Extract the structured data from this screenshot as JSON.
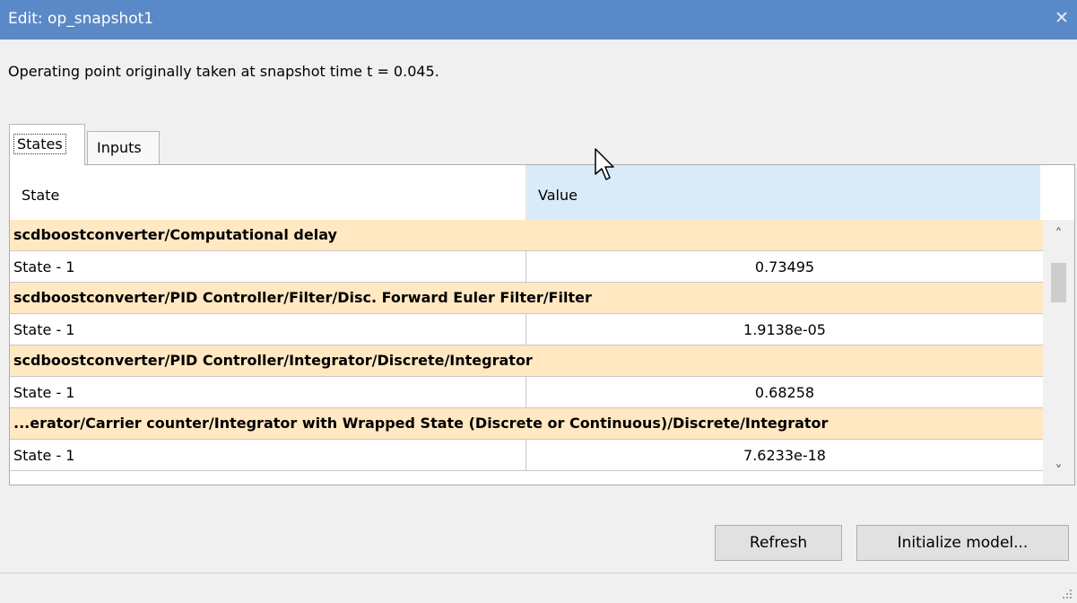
{
  "window": {
    "title": "Edit: op_snapshot1",
    "close_glyph": "✕"
  },
  "info": {
    "text": "Operating point originally taken at snapshot time t = 0.045."
  },
  "tabs": [
    {
      "label": "States",
      "selected": true
    },
    {
      "label": "Inputs",
      "selected": false
    }
  ],
  "table": {
    "columns": [
      "State",
      "Value"
    ],
    "rows": [
      {
        "kind": "group",
        "label": "scdboostconverter/Computational delay"
      },
      {
        "kind": "state",
        "name": "State - 1",
        "value": "0.73495"
      },
      {
        "kind": "group",
        "label": "scdboostconverter/PID Controller/Filter/Disc. Forward Euler Filter/Filter"
      },
      {
        "kind": "state",
        "name": "State - 1",
        "value": "1.9138e-05"
      },
      {
        "kind": "group",
        "label": "scdboostconverter/PID Controller/Integrator/Discrete/Integrator"
      },
      {
        "kind": "state",
        "name": "State - 1",
        "value": "0.68258"
      },
      {
        "kind": "group",
        "label": "...erator/Carrier counter/Integrator with Wrapped State (Discrete or Continuous)/Discrete/Integrator"
      },
      {
        "kind": "state",
        "name": "State - 1",
        "value": "7.6233e-18"
      }
    ]
  },
  "scrollbar": {
    "up_glyph": "˄",
    "down_glyph": "˅"
  },
  "buttons": {
    "refresh": "Refresh",
    "initialize": "Initialize model..."
  },
  "colors": {
    "titlebar": "#5a89c7",
    "group_row": "#ffe8c2",
    "value_header": "#d9ebf9",
    "button_bg": "#e1e1e1"
  }
}
